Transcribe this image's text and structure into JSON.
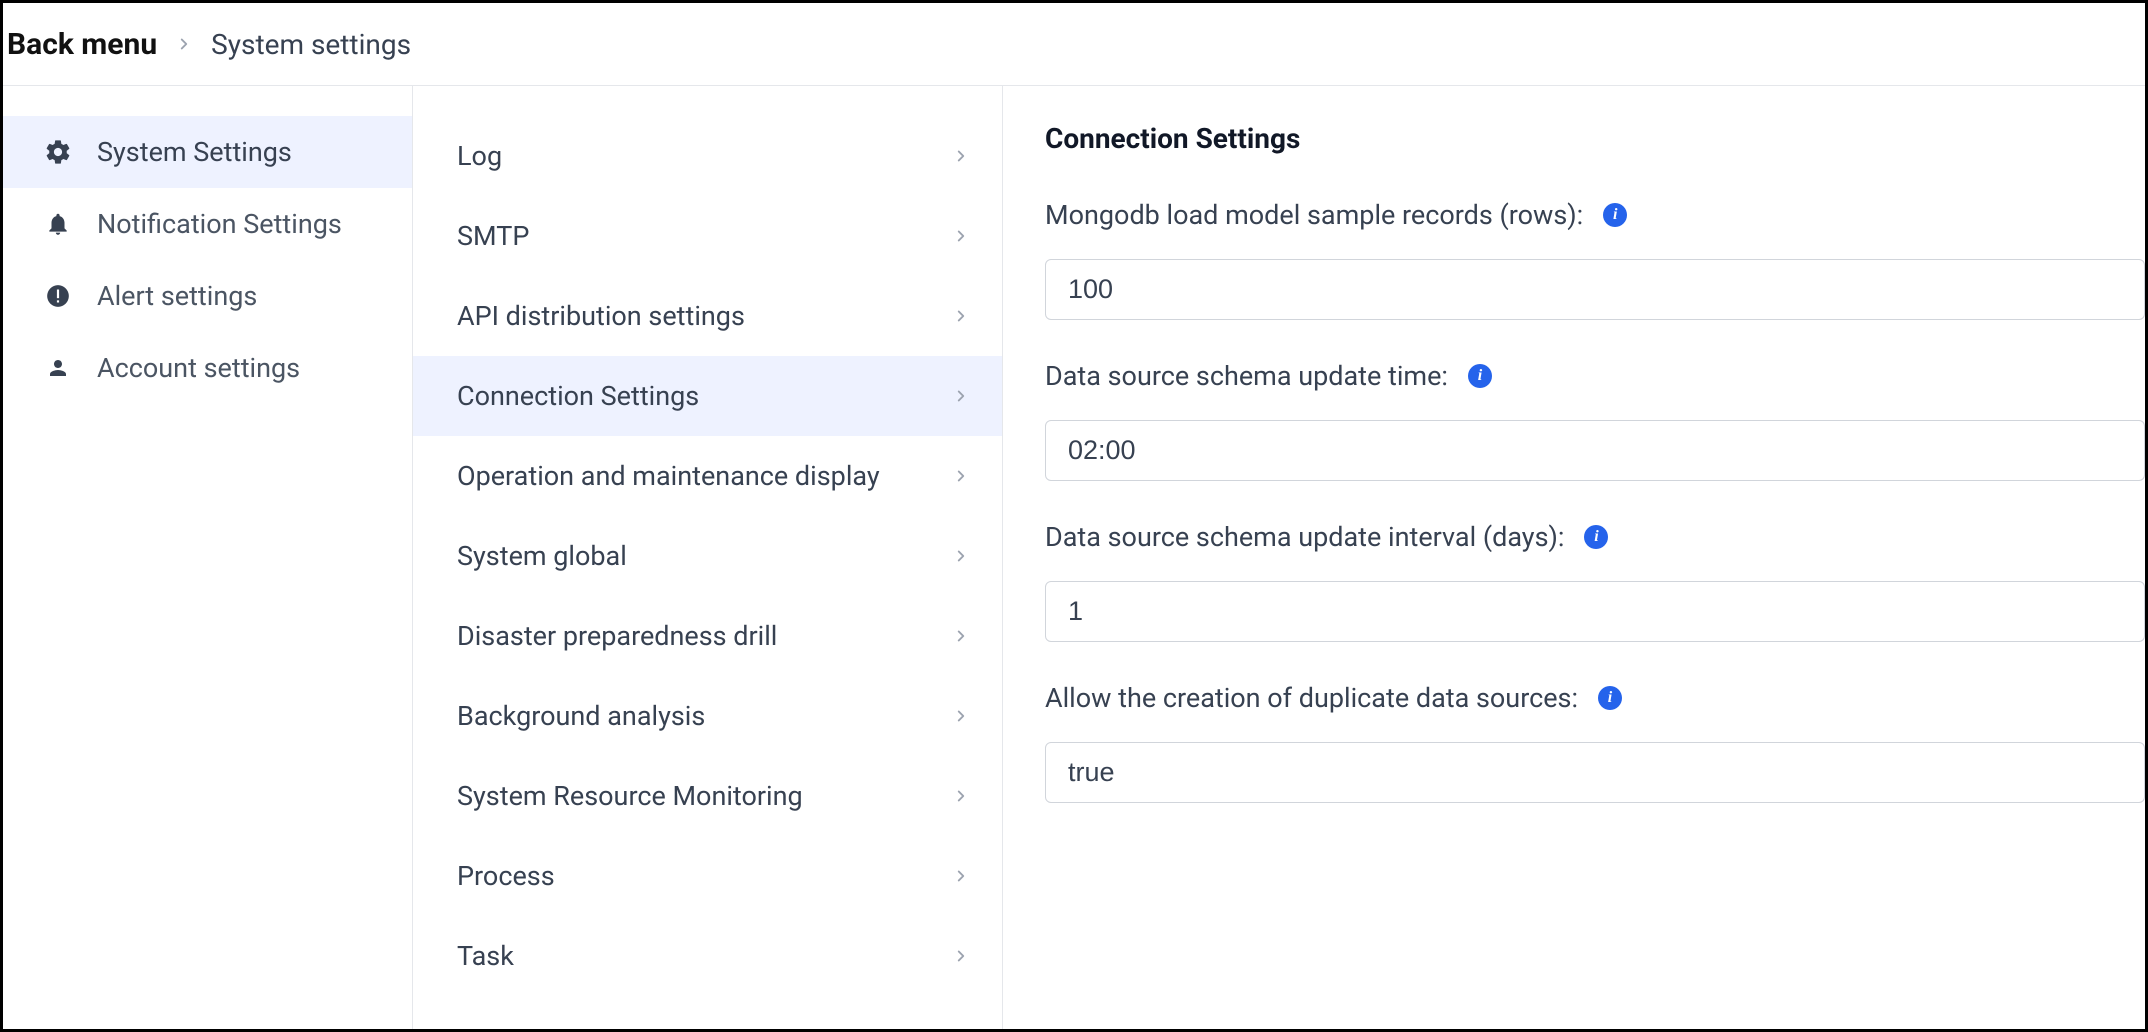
{
  "breadcrumb": {
    "back": "Back menu",
    "current": "System settings"
  },
  "sidebar": {
    "items": [
      {
        "label": "System Settings",
        "icon": "gear-icon",
        "active": true
      },
      {
        "label": "Notification Settings",
        "icon": "bell-icon",
        "active": false
      },
      {
        "label": "Alert settings",
        "icon": "alert-icon",
        "active": false
      },
      {
        "label": "Account settings",
        "icon": "user-icon",
        "active": false
      }
    ]
  },
  "submenu": {
    "items": [
      {
        "label": "Log",
        "active": false
      },
      {
        "label": "SMTP",
        "active": false
      },
      {
        "label": "API distribution settings",
        "active": false
      },
      {
        "label": "Connection Settings",
        "active": true
      },
      {
        "label": "Operation and maintenance display",
        "active": false
      },
      {
        "label": "System global",
        "active": false
      },
      {
        "label": "Disaster preparedness drill",
        "active": false
      },
      {
        "label": "Background analysis",
        "active": false
      },
      {
        "label": "System Resource Monitoring",
        "active": false
      },
      {
        "label": "Process",
        "active": false
      },
      {
        "label": "Task",
        "active": false
      }
    ]
  },
  "content": {
    "title": "Connection Settings",
    "fields": [
      {
        "label": "Mongodb load model sample records (rows):",
        "value": "100",
        "info": true
      },
      {
        "label": "Data source schema update time:",
        "value": "02:00",
        "info": true
      },
      {
        "label": "Data source schema update interval (days):",
        "value": "1",
        "info": true
      },
      {
        "label": "Allow the creation of duplicate data sources:",
        "value": "true",
        "info": true
      }
    ]
  },
  "icons": {
    "info_glyph": "i"
  }
}
